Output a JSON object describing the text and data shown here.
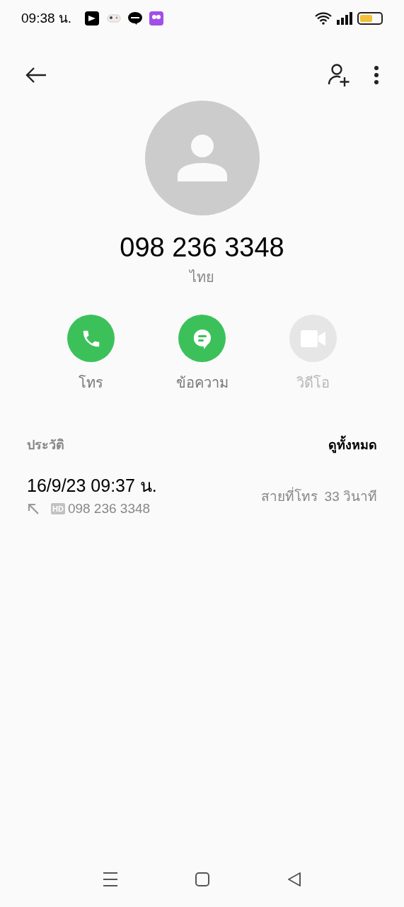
{
  "status_bar": {
    "time": "09:38 น."
  },
  "contact": {
    "number": "098 236 3348",
    "region": "ไทย"
  },
  "actions": [
    {
      "kind": "call",
      "label": "โทร",
      "disabled": false
    },
    {
      "kind": "message",
      "label": "ข้อความ",
      "disabled": false
    },
    {
      "kind": "video",
      "label": "วิดีโอ",
      "disabled": true
    }
  ],
  "history": {
    "title": "ประวัติ",
    "view_all": "ดูทั้งหมด",
    "entries": [
      {
        "datetime": "16/9/23 09:37 น.",
        "badge": "HD",
        "number": "098 236 3348",
        "call_type": "สายที่โทร",
        "duration": "33 วินาที"
      }
    ]
  }
}
